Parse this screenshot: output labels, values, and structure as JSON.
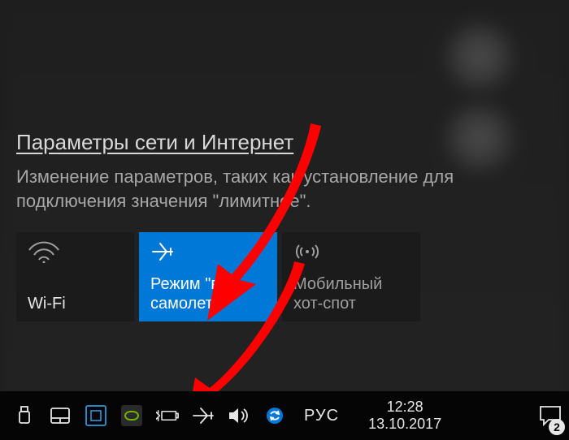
{
  "flyout": {
    "settings_link": "Параметры сети и Интернет",
    "settings_desc": "Изменение параметров, таких как установление для подключения значения \"лимитное\"."
  },
  "tiles": {
    "wifi": {
      "label": "Wi-Fi",
      "icon": "wifi-icon"
    },
    "airplane": {
      "label": "Режим \"в самолете\"",
      "icon": "airplane-icon"
    },
    "hotspot": {
      "label": "Мобильный хот-спот",
      "icon": "hotspot-icon"
    }
  },
  "tray": {
    "icons": [
      "usb-icon",
      "touchpad-icon",
      "display-icon",
      "nvidia-icon",
      "battery-icon",
      "airplane-icon",
      "volume-icon",
      "sync-icon"
    ],
    "language": "РУС",
    "time": "12:28",
    "date": "13.10.2017",
    "action_center_count": "2"
  }
}
